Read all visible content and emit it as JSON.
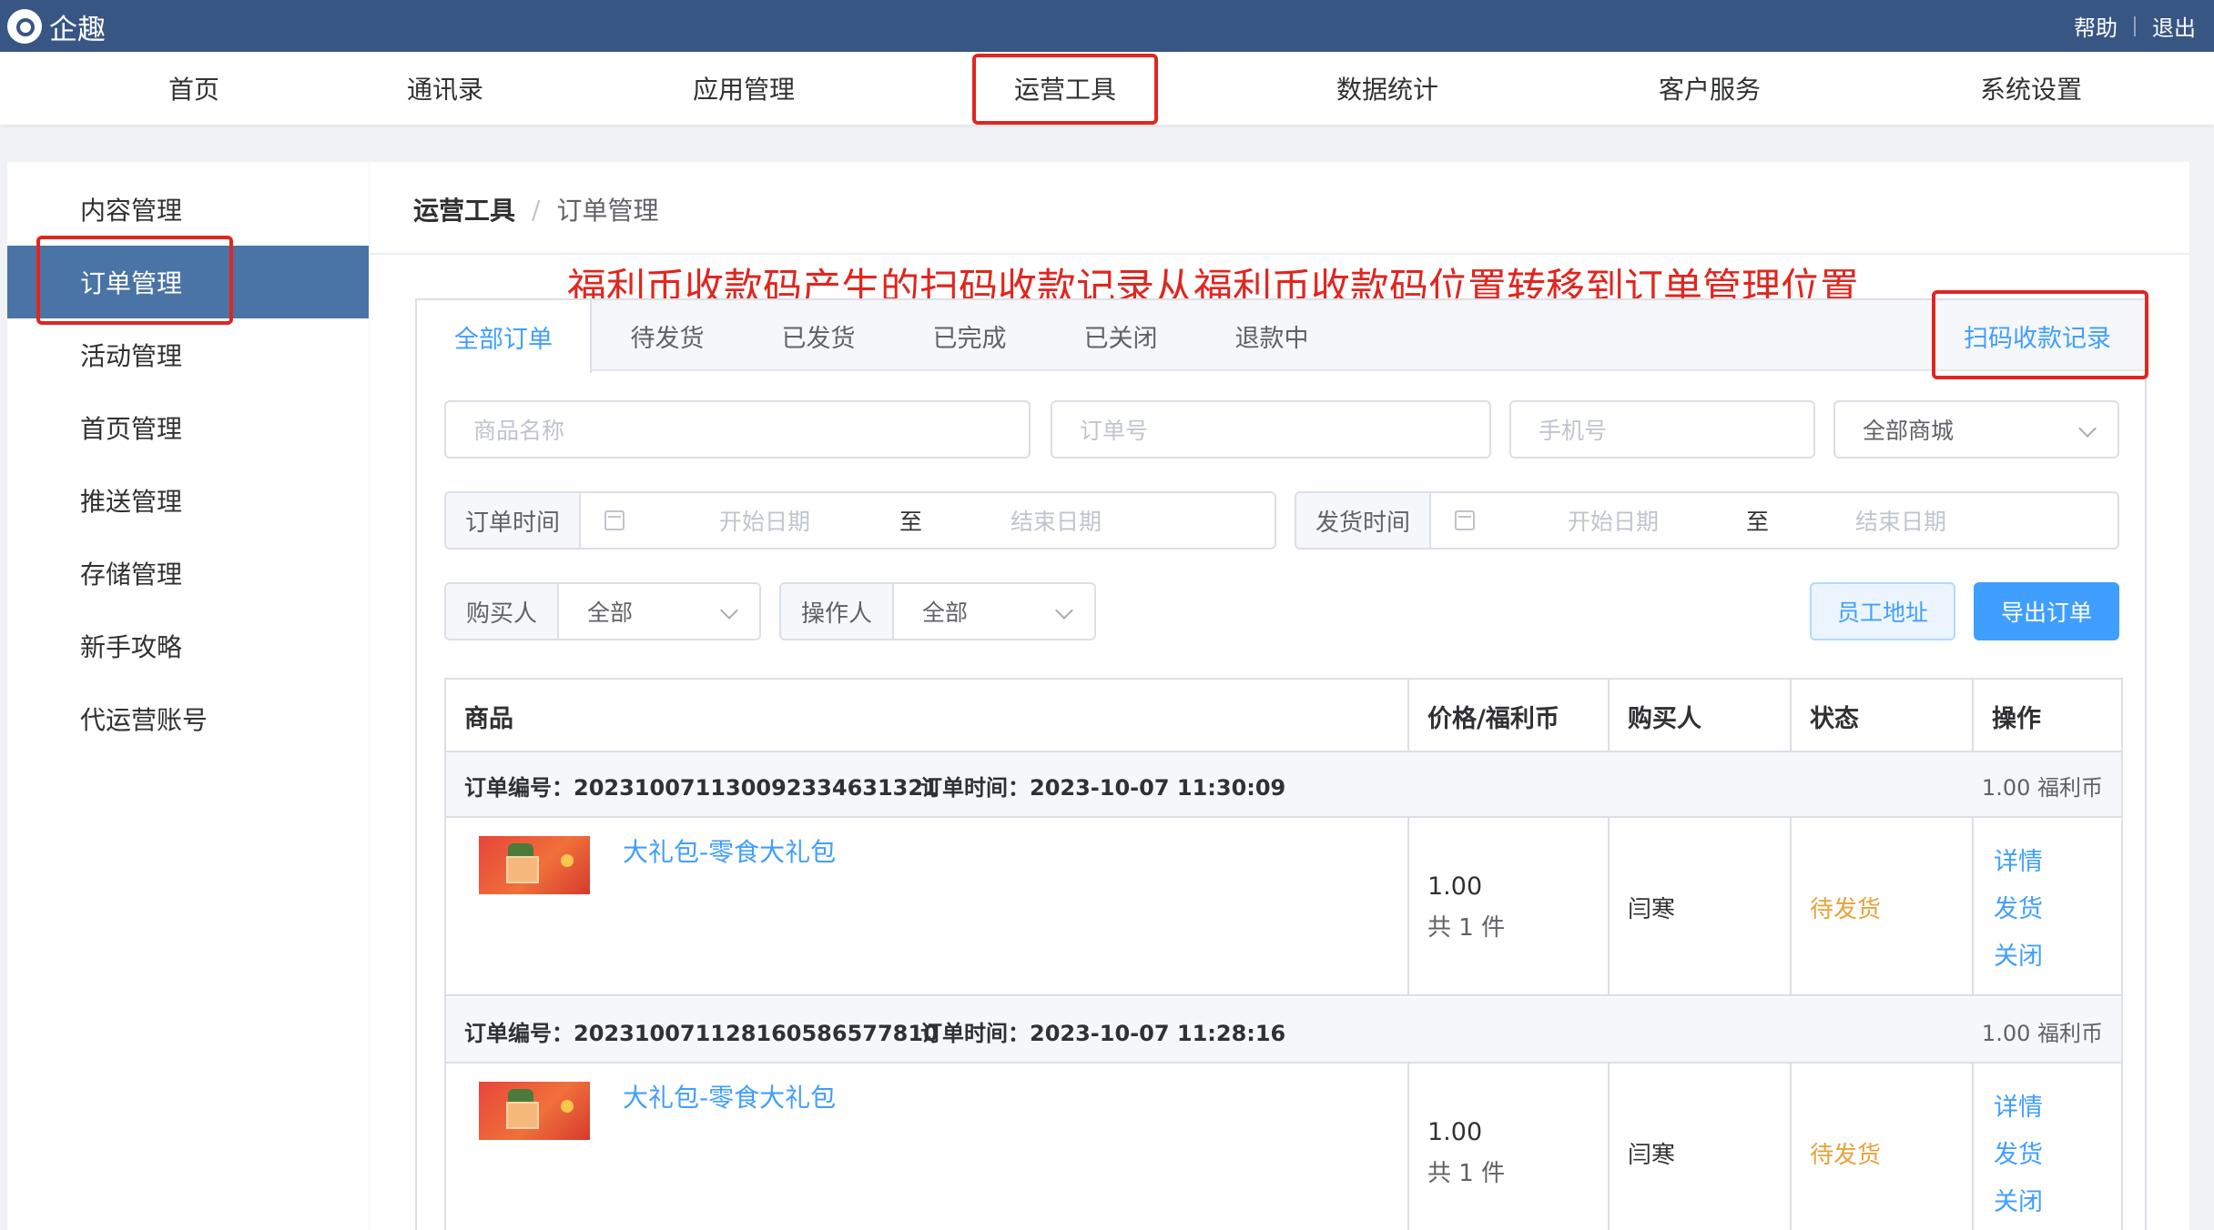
{
  "app": {
    "logo_text": "企趣"
  },
  "topbar": {
    "help_label": "帮助",
    "logout_label": "退出"
  },
  "mainnav": {
    "items": [
      {
        "label": "首页"
      },
      {
        "label": "通讯录"
      },
      {
        "label": "应用管理"
      },
      {
        "label": "运营工具",
        "active": true
      },
      {
        "label": "数据统计"
      },
      {
        "label": "客户服务"
      },
      {
        "label": "系统设置"
      }
    ]
  },
  "sidebar": {
    "items": [
      {
        "label": "内容管理"
      },
      {
        "label": "订单管理",
        "active": true
      },
      {
        "label": "活动管理"
      },
      {
        "label": "首页管理"
      },
      {
        "label": "推送管理"
      },
      {
        "label": "存储管理"
      },
      {
        "label": "新手攻略"
      },
      {
        "label": "代运营账号"
      }
    ]
  },
  "breadcrumb": {
    "parent": "运营工具",
    "separator": "/",
    "current": "订单管理"
  },
  "annotation": "福利币收款码产生的扫码收款记录从福利币收款码位置转移到订单管理位置",
  "tabs": {
    "items": [
      {
        "label": "全部订单",
        "active": true
      },
      {
        "label": "待发货"
      },
      {
        "label": "已发货"
      },
      {
        "label": "已完成"
      },
      {
        "label": "已关闭"
      },
      {
        "label": "退款中"
      }
    ],
    "scan_records_label": "扫码收款记录"
  },
  "filters": {
    "product_name_placeholder": "商品名称",
    "order_no_placeholder": "订单号",
    "phone_placeholder": "手机号",
    "mall_select": "全部商城",
    "order_time": {
      "label": "订单时间",
      "start": "开始日期",
      "to": "至",
      "end": "结束日期"
    },
    "ship_time": {
      "label": "发货时间",
      "start": "开始日期",
      "to": "至",
      "end": "结束日期"
    },
    "buyer": {
      "label": "购买人",
      "value": "全部"
    },
    "operator": {
      "label": "操作人",
      "value": "全部"
    },
    "staff_address_label": "员工地址",
    "export_label": "导出订单"
  },
  "table": {
    "columns": [
      "商品",
      "价格/福利币",
      "购买人",
      "状态",
      "操作"
    ],
    "orders": [
      {
        "order_no": "订单编号：20231007113009233463 1321",
        "order_time": "订单时间：2023-10-07 11:30:09",
        "total": "1.00 福利币",
        "product": "大礼包-零食大礼包",
        "price": "1.00",
        "qty": "共 1 件",
        "buyer": "闫寒",
        "status": "待发货",
        "actions": [
          "详情",
          "发货",
          "关闭"
        ]
      },
      {
        "order_no": "订单编号：20231007112816058657 7810",
        "order_time": "订单时间：2023-10-07 11:28:16",
        "total": "1.00 福利币",
        "product": "大礼包-零食大礼包",
        "price": "1.00",
        "qty": "共 1 件",
        "buyer": "闫寒",
        "status": "待发货",
        "actions": [
          "详情",
          "发货",
          "关闭"
        ]
      }
    ]
  },
  "colors": {
    "topbar": "#385684",
    "sidebar_active": "#4a74a5",
    "primary": "#409eff",
    "warning": "#e6a23c",
    "annotation_red": "#e0261f"
  }
}
